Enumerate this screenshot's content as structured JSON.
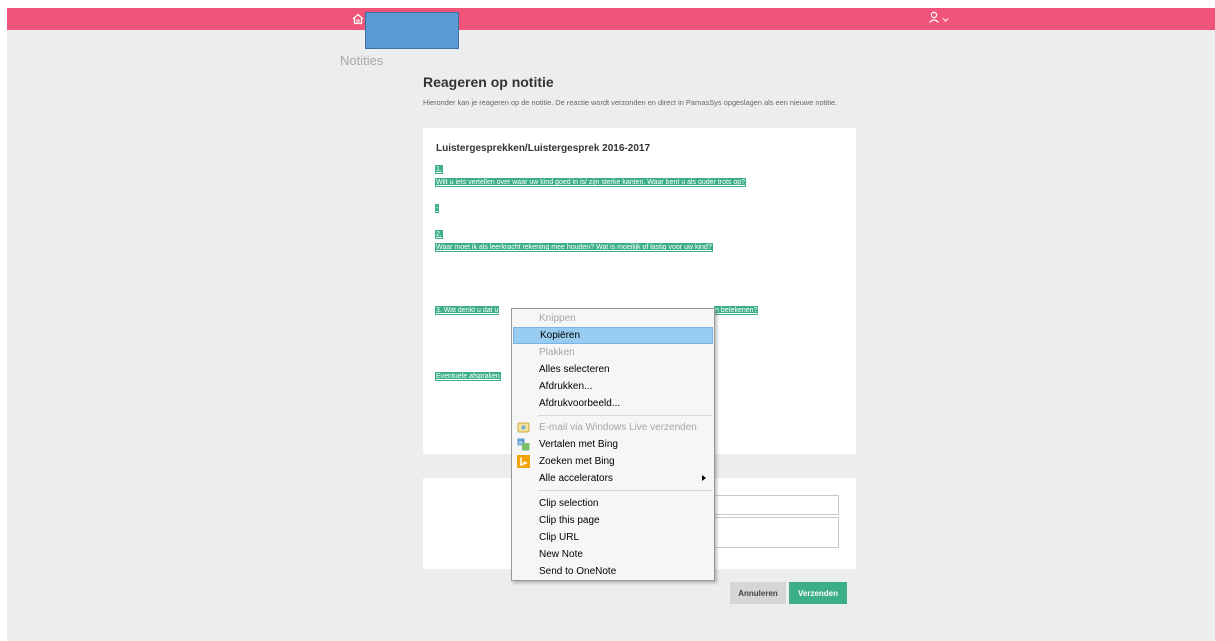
{
  "header": {
    "home_icon": "home-icon",
    "user_icon": "user-icon",
    "chevron_icon": "chevron-down-icon",
    "accent": "#f0547a"
  },
  "section_title": "Notities",
  "page": {
    "heading": "Reageren op notitie",
    "intro": "Hieronder kan je reageren op de notitie. De reactie wordt verzonden en direct in ParnasSys opgeslagen als een nieuwe notitie."
  },
  "note": {
    "title": "Luistergesprekken/Luistergesprek 2016-2017",
    "q1_number": "1.",
    "q1_text": "Wilt u iets vertellen over waar uw kind goed in is/ zijn sterke kanten. Waar bent u als ouder trots op?",
    "q1_answer": "-",
    "q2_number": "2.",
    "q2_text": "Waar moet ik als leerkracht rekening mee houden? Wat is moeilijk of lastig voor uw kind?",
    "q3_start": "3. Wat denkt u dat u",
    "q3_end": "n betekenen?",
    "agreements": "Eventuele afspraken",
    "highlight_color": "#3cae8a"
  },
  "buttons": {
    "cancel": "Annuleren",
    "send": "Verzenden"
  },
  "context_menu": {
    "cut": "Knippen",
    "copy": "Kopiëren",
    "paste": "Plakken",
    "select_all": "Alles selecteren",
    "print": "Afdrukken...",
    "print_preview": "Afdrukvoorbeeld...",
    "email": "E-mail via Windows Live verzenden",
    "translate": "Vertalen met Bing",
    "search": "Zoeken met Bing",
    "accelerators": "Alle accelerators",
    "clip_selection": "Clip selection",
    "clip_page": "Clip this page",
    "clip_url": "Clip URL",
    "new_note": "New Note",
    "send_onenote": "Send to OneNote"
  }
}
